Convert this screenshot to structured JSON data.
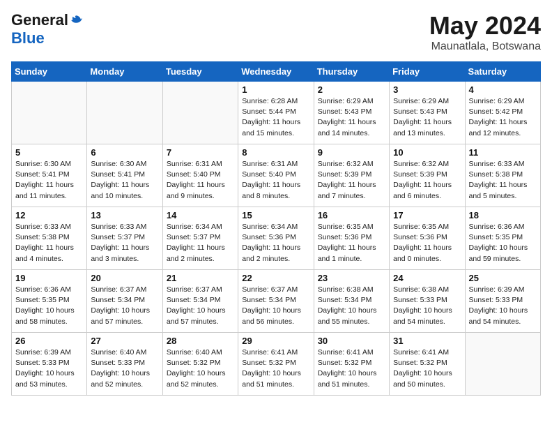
{
  "logo": {
    "general": "General",
    "blue": "Blue"
  },
  "title": "May 2024",
  "location": "Maunatlala, Botswana",
  "days_header": [
    "Sunday",
    "Monday",
    "Tuesday",
    "Wednesday",
    "Thursday",
    "Friday",
    "Saturday"
  ],
  "weeks": [
    [
      {
        "day": "",
        "info": ""
      },
      {
        "day": "",
        "info": ""
      },
      {
        "day": "",
        "info": ""
      },
      {
        "day": "1",
        "info": "Sunrise: 6:28 AM\nSunset: 5:44 PM\nDaylight: 11 hours\nand 15 minutes."
      },
      {
        "day": "2",
        "info": "Sunrise: 6:29 AM\nSunset: 5:43 PM\nDaylight: 11 hours\nand 14 minutes."
      },
      {
        "day": "3",
        "info": "Sunrise: 6:29 AM\nSunset: 5:43 PM\nDaylight: 11 hours\nand 13 minutes."
      },
      {
        "day": "4",
        "info": "Sunrise: 6:29 AM\nSunset: 5:42 PM\nDaylight: 11 hours\nand 12 minutes."
      }
    ],
    [
      {
        "day": "5",
        "info": "Sunrise: 6:30 AM\nSunset: 5:41 PM\nDaylight: 11 hours\nand 11 minutes."
      },
      {
        "day": "6",
        "info": "Sunrise: 6:30 AM\nSunset: 5:41 PM\nDaylight: 11 hours\nand 10 minutes."
      },
      {
        "day": "7",
        "info": "Sunrise: 6:31 AM\nSunset: 5:40 PM\nDaylight: 11 hours\nand 9 minutes."
      },
      {
        "day": "8",
        "info": "Sunrise: 6:31 AM\nSunset: 5:40 PM\nDaylight: 11 hours\nand 8 minutes."
      },
      {
        "day": "9",
        "info": "Sunrise: 6:32 AM\nSunset: 5:39 PM\nDaylight: 11 hours\nand 7 minutes."
      },
      {
        "day": "10",
        "info": "Sunrise: 6:32 AM\nSunset: 5:39 PM\nDaylight: 11 hours\nand 6 minutes."
      },
      {
        "day": "11",
        "info": "Sunrise: 6:33 AM\nSunset: 5:38 PM\nDaylight: 11 hours\nand 5 minutes."
      }
    ],
    [
      {
        "day": "12",
        "info": "Sunrise: 6:33 AM\nSunset: 5:38 PM\nDaylight: 11 hours\nand 4 minutes."
      },
      {
        "day": "13",
        "info": "Sunrise: 6:33 AM\nSunset: 5:37 PM\nDaylight: 11 hours\nand 3 minutes."
      },
      {
        "day": "14",
        "info": "Sunrise: 6:34 AM\nSunset: 5:37 PM\nDaylight: 11 hours\nand 2 minutes."
      },
      {
        "day": "15",
        "info": "Sunrise: 6:34 AM\nSunset: 5:36 PM\nDaylight: 11 hours\nand 2 minutes."
      },
      {
        "day": "16",
        "info": "Sunrise: 6:35 AM\nSunset: 5:36 PM\nDaylight: 11 hours\nand 1 minute."
      },
      {
        "day": "17",
        "info": "Sunrise: 6:35 AM\nSunset: 5:36 PM\nDaylight: 11 hours\nand 0 minutes."
      },
      {
        "day": "18",
        "info": "Sunrise: 6:36 AM\nSunset: 5:35 PM\nDaylight: 10 hours\nand 59 minutes."
      }
    ],
    [
      {
        "day": "19",
        "info": "Sunrise: 6:36 AM\nSunset: 5:35 PM\nDaylight: 10 hours\nand 58 minutes."
      },
      {
        "day": "20",
        "info": "Sunrise: 6:37 AM\nSunset: 5:34 PM\nDaylight: 10 hours\nand 57 minutes."
      },
      {
        "day": "21",
        "info": "Sunrise: 6:37 AM\nSunset: 5:34 PM\nDaylight: 10 hours\nand 57 minutes."
      },
      {
        "day": "22",
        "info": "Sunrise: 6:37 AM\nSunset: 5:34 PM\nDaylight: 10 hours\nand 56 minutes."
      },
      {
        "day": "23",
        "info": "Sunrise: 6:38 AM\nSunset: 5:34 PM\nDaylight: 10 hours\nand 55 minutes."
      },
      {
        "day": "24",
        "info": "Sunrise: 6:38 AM\nSunset: 5:33 PM\nDaylight: 10 hours\nand 54 minutes."
      },
      {
        "day": "25",
        "info": "Sunrise: 6:39 AM\nSunset: 5:33 PM\nDaylight: 10 hours\nand 54 minutes."
      }
    ],
    [
      {
        "day": "26",
        "info": "Sunrise: 6:39 AM\nSunset: 5:33 PM\nDaylight: 10 hours\nand 53 minutes."
      },
      {
        "day": "27",
        "info": "Sunrise: 6:40 AM\nSunset: 5:33 PM\nDaylight: 10 hours\nand 52 minutes."
      },
      {
        "day": "28",
        "info": "Sunrise: 6:40 AM\nSunset: 5:32 PM\nDaylight: 10 hours\nand 52 minutes."
      },
      {
        "day": "29",
        "info": "Sunrise: 6:41 AM\nSunset: 5:32 PM\nDaylight: 10 hours\nand 51 minutes."
      },
      {
        "day": "30",
        "info": "Sunrise: 6:41 AM\nSunset: 5:32 PM\nDaylight: 10 hours\nand 51 minutes."
      },
      {
        "day": "31",
        "info": "Sunrise: 6:41 AM\nSunset: 5:32 PM\nDaylight: 10 hours\nand 50 minutes."
      },
      {
        "day": "",
        "info": ""
      }
    ]
  ]
}
